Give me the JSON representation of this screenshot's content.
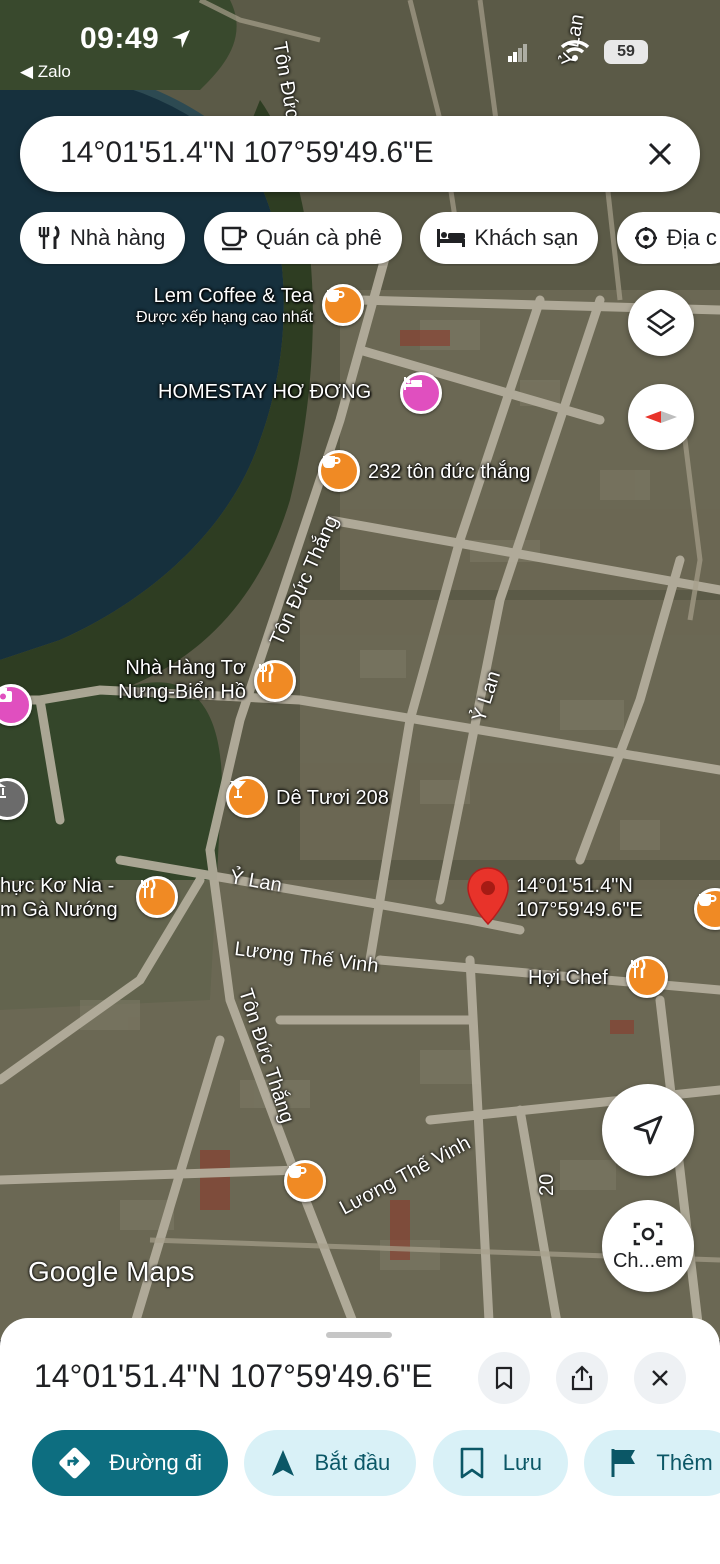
{
  "status_bar": {
    "time": "09:49",
    "back_label": "◀ Zalo",
    "battery": "59"
  },
  "search": {
    "query": "14°01'51.4\"N 107°59'49.6\"E"
  },
  "chips": [
    {
      "label": "Nhà hàng",
      "icon": "restaurant-icon"
    },
    {
      "label": "Quán cà phê",
      "icon": "coffee-icon"
    },
    {
      "label": "Khách sạn",
      "icon": "hotel-icon"
    },
    {
      "label": "Địa c",
      "icon": "attraction-icon"
    }
  ],
  "map": {
    "pois": [
      {
        "name": "Lem Coffee & Tea",
        "sub": "Được xếp hạng cao nhất",
        "icon": "coffee-icon"
      },
      {
        "name": "HOMESTAY HƠ ĐƠNG",
        "icon": "hotel-icon"
      },
      {
        "name": "232 tôn đức thắng",
        "icon": "coffee-icon"
      },
      {
        "name": "Nhà Hàng Tơ",
        "name2": "Nưng-Biển Hồ",
        "icon": "restaurant-icon"
      },
      {
        "name": "Dê Tươi 208",
        "icon": "bar-icon"
      },
      {
        "name": "hực Kơ Nia -",
        "name2": "m Gà Nướng",
        "icon": "restaurant-icon"
      },
      {
        "name": "Hợi Chef",
        "icon": "restaurant-icon"
      },
      {
        "name": "",
        "icon": "coffee-icon"
      }
    ],
    "pin_label_1": "14°01'51.4\"N",
    "pin_label_2": "107°59'49.6\"E",
    "roads": [
      "Tôn Đức Th",
      "Ỷ Lan",
      "Tôn Đức Thắng",
      "Ỷ Lan",
      "Ỷ Lan",
      "Lương Thế Vinh",
      "Tôn Đức Thắng",
      "Lương Thế Vinh",
      "20"
    ],
    "google_logo": "Google Maps",
    "lens_label": "Ch...em"
  },
  "sheet": {
    "title": "14°01'51.4\"N 107°59'49.6\"E",
    "actions": [
      {
        "label": "Đường đi",
        "icon": "directions-icon"
      },
      {
        "label": "Bắt đầu",
        "icon": "navigation-icon"
      },
      {
        "label": "Lưu",
        "icon": "bookmark-icon"
      },
      {
        "label": "Thêm",
        "icon": "flag-icon"
      }
    ]
  },
  "colors": {
    "accent": "#0d6e80",
    "accent_light": "#d9f1f7",
    "poi_orange": "#f08a24",
    "poi_pink": "#e04fbf",
    "pin_red": "#e8332a"
  }
}
